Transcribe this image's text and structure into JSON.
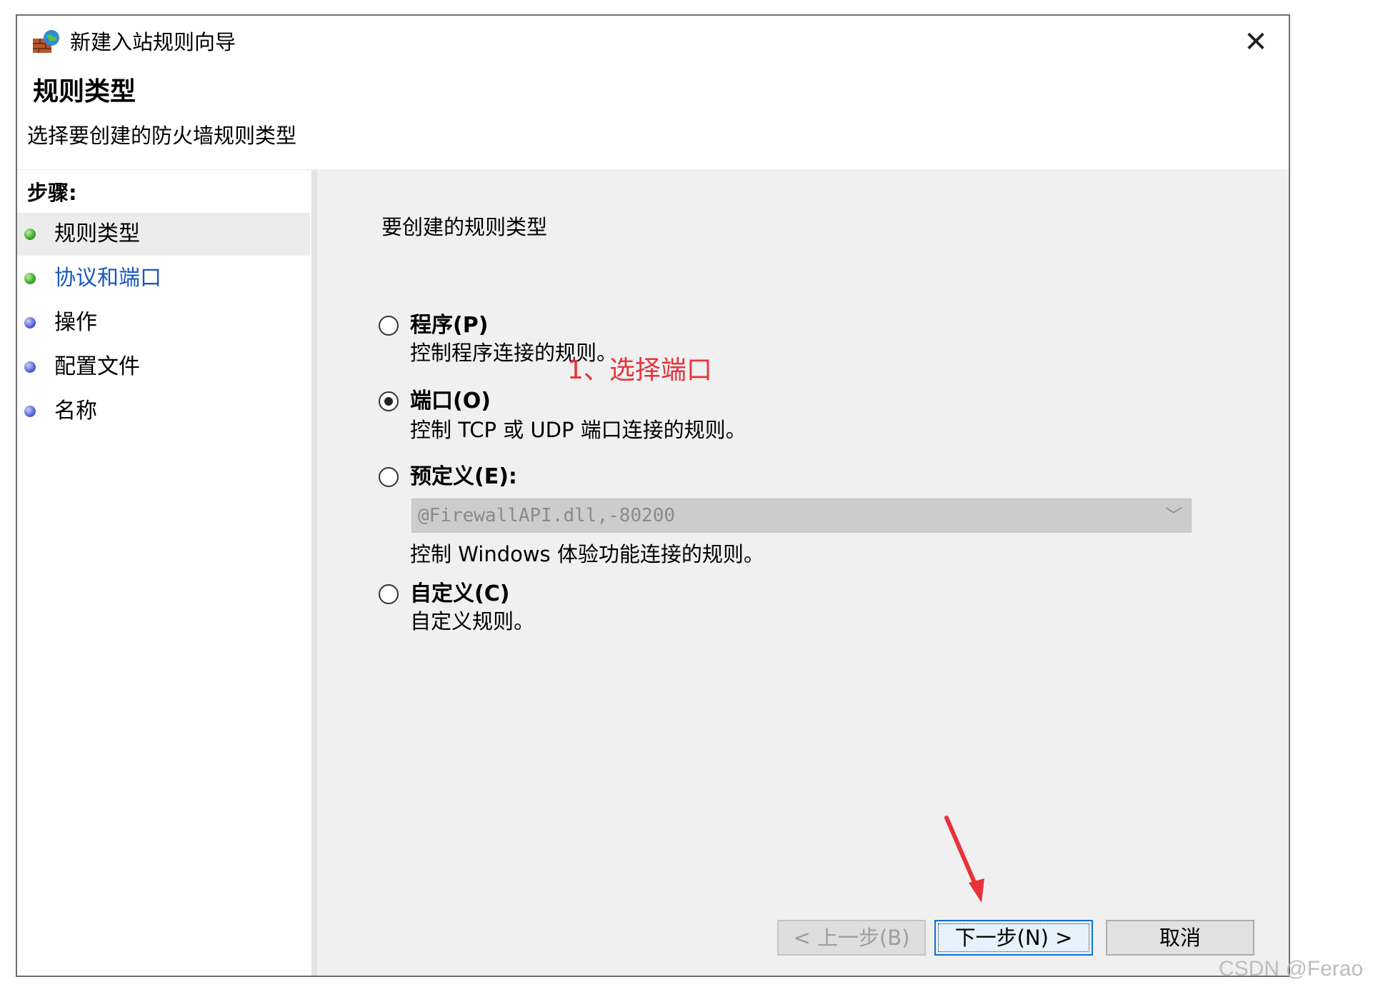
{
  "window": {
    "title": "新建入站规则向导",
    "close_label": "✕"
  },
  "header": {
    "title": "规则类型",
    "subtitle": "选择要创建的防火墙规则类型"
  },
  "sidebar": {
    "heading": "步骤:",
    "steps": [
      {
        "label": "规则类型",
        "dot_color": "green",
        "active": true
      },
      {
        "label": "协议和端口",
        "dot_color": "green",
        "link": true
      },
      {
        "label": "操作",
        "dot_color": "blue"
      },
      {
        "label": "配置文件",
        "dot_color": "blue"
      },
      {
        "label": "名称",
        "dot_color": "blue"
      }
    ]
  },
  "content": {
    "heading": "要创建的规则类型",
    "options": [
      {
        "label": "程序(P)",
        "desc": "控制程序连接的规则。",
        "checked": false
      },
      {
        "label": "端口(O)",
        "desc": "控制 TCP 或 UDP 端口连接的规则。",
        "checked": true
      },
      {
        "label": "预定义(E):",
        "desc": "控制 Windows 体验功能连接的规则。",
        "checked": false
      },
      {
        "label": "自定义(C)",
        "desc": "自定义规则。",
        "checked": false
      }
    ],
    "predefined_select_value": "@FirewallAPI.dll,-80200",
    "annotation": "1、选择端口"
  },
  "buttons": {
    "back": "< 上一步(B)",
    "next": "下一步(N) >",
    "cancel": "取消"
  },
  "colors": {
    "link": "#1a57b8",
    "annotation": "#e8323a",
    "primary_border": "#0f6fd1"
  },
  "watermark": "CSDN @Ferao"
}
